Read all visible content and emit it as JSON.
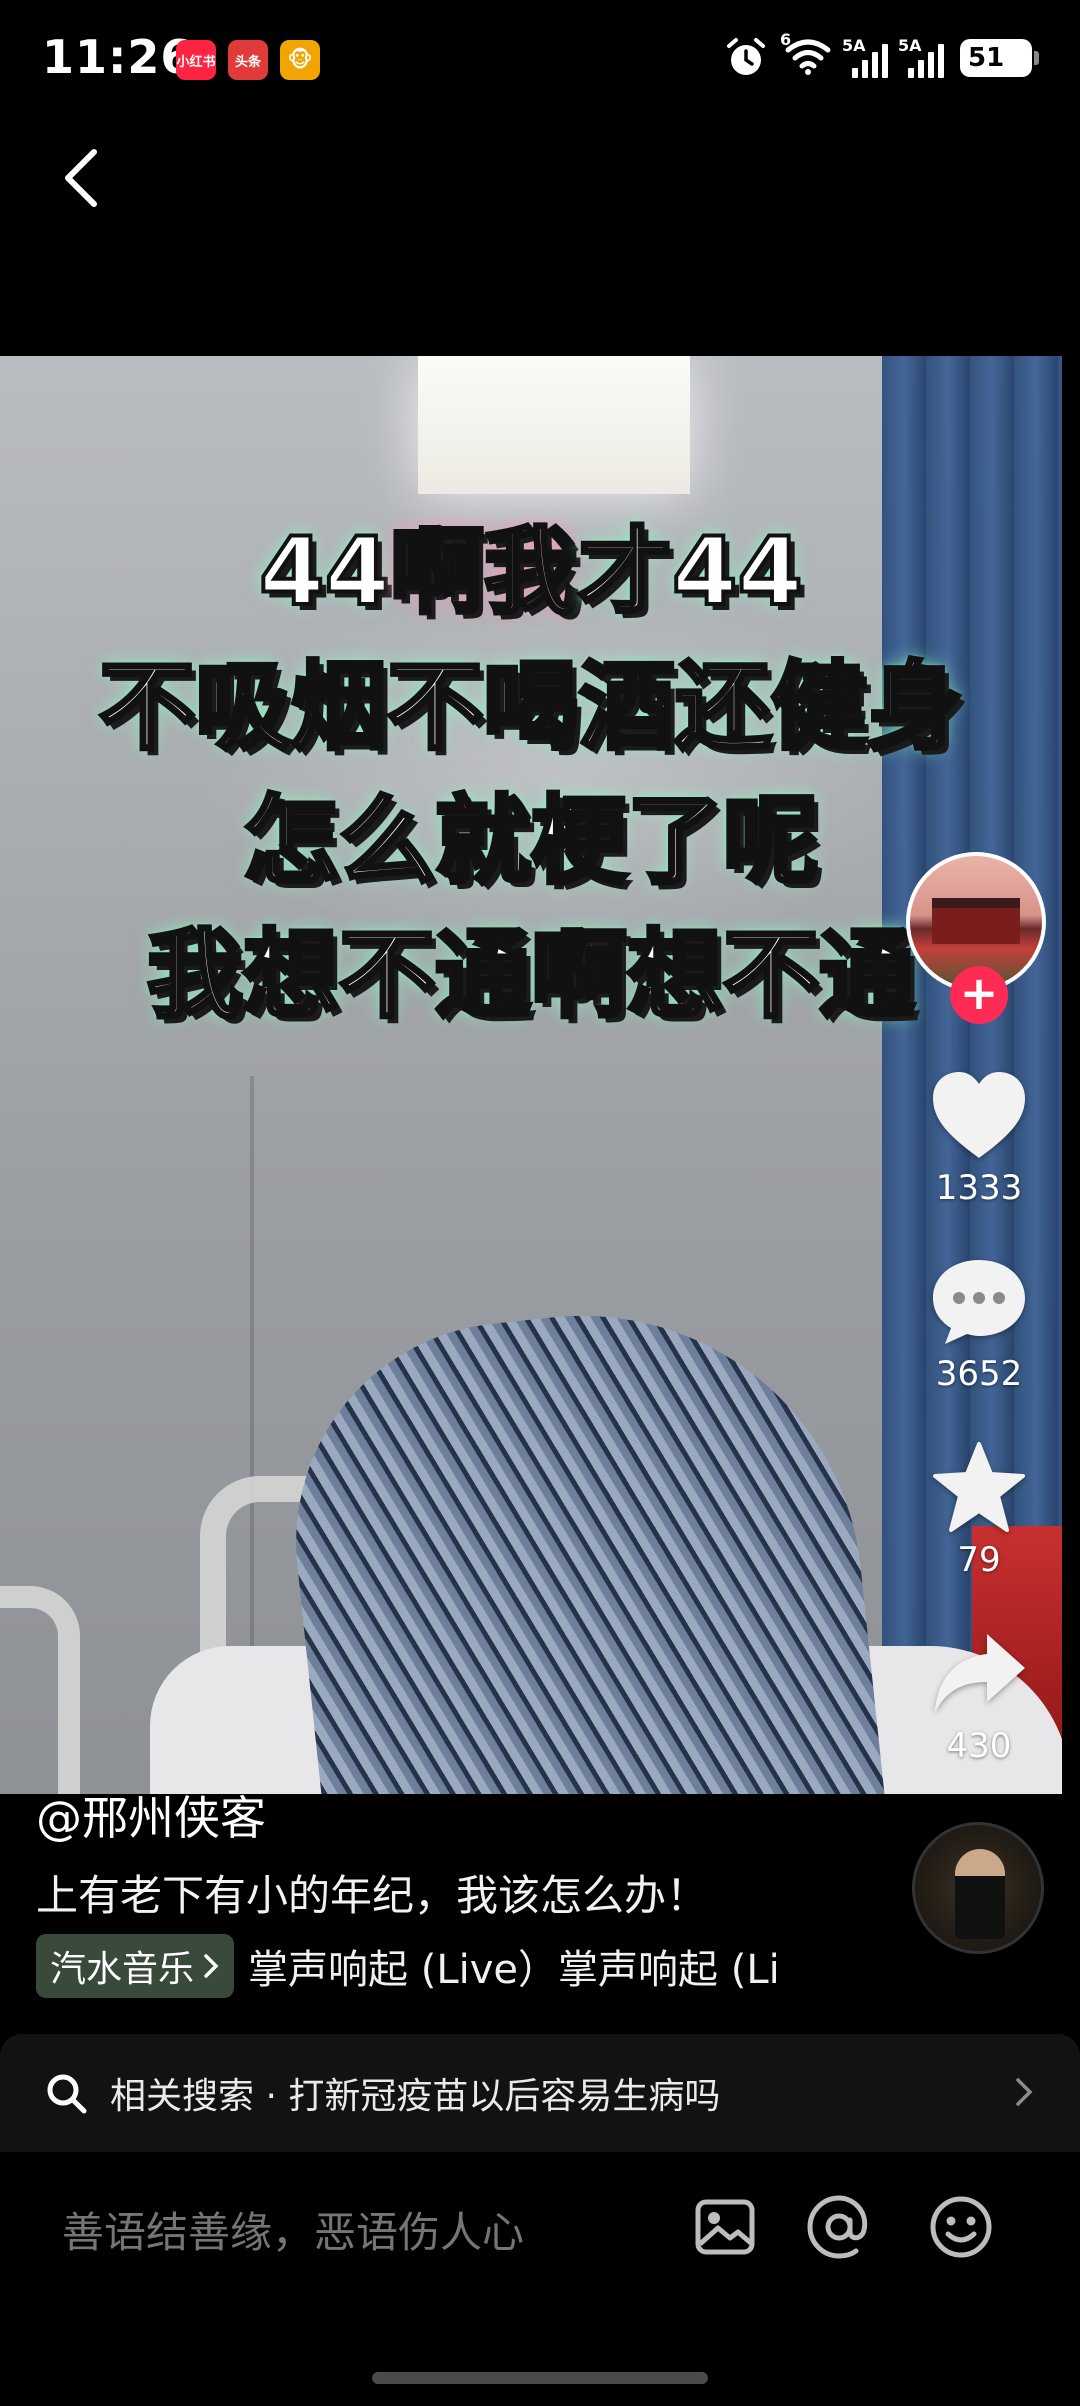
{
  "status_bar": {
    "time": "11:26",
    "notifications": [
      "小红书",
      "头条",
      "🐵"
    ],
    "signal_1_label": "5A",
    "signal_2_label": "5A",
    "wifi_label": "6",
    "battery_level": "51"
  },
  "nav": {
    "back_icon": "chevron-left-icon"
  },
  "video": {
    "overlay_lines": [
      "44啊我才44",
      "不吸烟不喝酒还健身",
      "怎么就梗了呢",
      "我想不通啊想不通"
    ],
    "overlay_line1_pre": "44",
    "overlay_line1_hl": "啊我",
    "overlay_line1_post": "才44"
  },
  "actions": {
    "likes": "1333",
    "comments": "3652",
    "favorites": "79",
    "shares": "430",
    "follow_symbol": "+"
  },
  "post": {
    "author": "@邢州侠客",
    "description": "上有老下有小的年纪，我该怎么办！",
    "music_tag": "汽水音乐",
    "music_title": "掌声响起 (Live）掌声响起 (Li"
  },
  "related_search": {
    "label": "相关搜索 · 打新冠疫苗以后容易生病吗"
  },
  "comment_bar": {
    "placeholder": "善语结善缘，恶语伤人心"
  },
  "colors": {
    "background": "#000000",
    "follow_button": "#fe2c55",
    "overlay_glow": "#8cffc8",
    "music_tag_bg": "#3a4a3a"
  }
}
